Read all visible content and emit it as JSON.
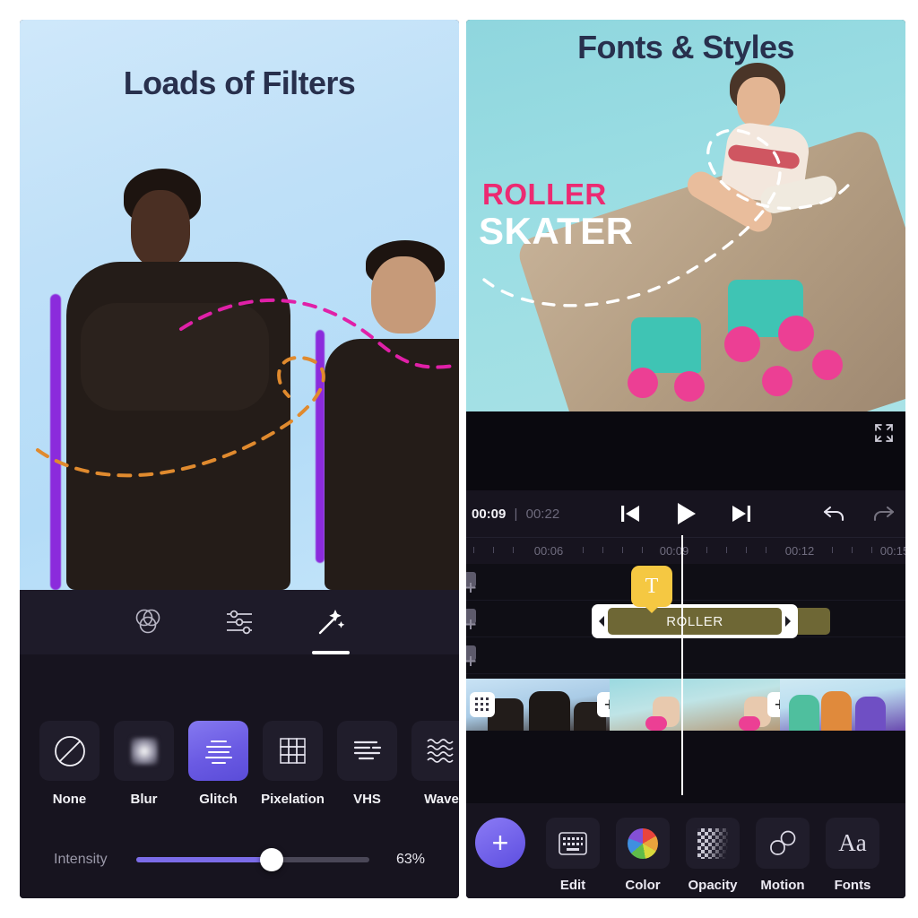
{
  "left_panel": {
    "promo_title": "Loads of Filters",
    "tabs": [
      {
        "name": "filters-tab",
        "icon": "overlapping-circles-icon",
        "active": false
      },
      {
        "name": "adjust-tab",
        "icon": "sliders-icon",
        "active": false
      },
      {
        "name": "effects-tab",
        "icon": "magic-wand-icon",
        "active": true
      }
    ],
    "filters": [
      {
        "label": "None",
        "icon": "no-filter-icon",
        "selected": false
      },
      {
        "label": "Blur",
        "icon": "blur-icon",
        "selected": false
      },
      {
        "label": "Glitch",
        "icon": "glitch-icon",
        "selected": true
      },
      {
        "label": "Pixelation",
        "icon": "pixelation-icon",
        "selected": false
      },
      {
        "label": "VHS",
        "icon": "vhs-icon",
        "selected": false
      },
      {
        "label": "Wave",
        "icon": "wave-icon",
        "selected": false
      }
    ],
    "intensity": {
      "label": "Intensity",
      "value_text": "63%",
      "value": 63
    }
  },
  "right_panel": {
    "promo_title": "Fonts & Styles",
    "overlay_text": {
      "line1": "ROLLER",
      "line2": "SKATER"
    },
    "player": {
      "current_time": "00:09",
      "separator": "|",
      "total_time": "00:22",
      "controls": [
        {
          "name": "skip-previous-button",
          "icon": "skip-previous-icon"
        },
        {
          "name": "play-button",
          "icon": "play-icon"
        },
        {
          "name": "skip-next-button",
          "icon": "skip-next-icon"
        }
      ],
      "history": [
        {
          "name": "undo-button",
          "icon": "undo-icon"
        },
        {
          "name": "redo-button",
          "icon": "redo-icon"
        }
      ],
      "expand": {
        "name": "fullscreen-button",
        "icon": "expand-icon"
      }
    },
    "timeline": {
      "ruler_labels": [
        "00:06",
        "00:09",
        "00:12",
        "00:15"
      ],
      "text_clip_label": "ROLLER",
      "text_badge_glyph": "T"
    },
    "toolbar": {
      "add_label": "+",
      "items": [
        {
          "label": "Edit",
          "icon": "keyboard-icon"
        },
        {
          "label": "Color",
          "icon": "color-wheel-icon"
        },
        {
          "label": "Opacity",
          "icon": "checkerboard-icon"
        },
        {
          "label": "Motion",
          "icon": "motion-shapes-icon"
        },
        {
          "label": "Fonts",
          "icon": "aa-icon"
        }
      ]
    }
  },
  "colors": {
    "accent_purple": "#6a5ae3",
    "pink": "#ec2a72",
    "yellow": "#f5c842",
    "panel_dark": "#17141f",
    "title_navy": "#28304d"
  }
}
